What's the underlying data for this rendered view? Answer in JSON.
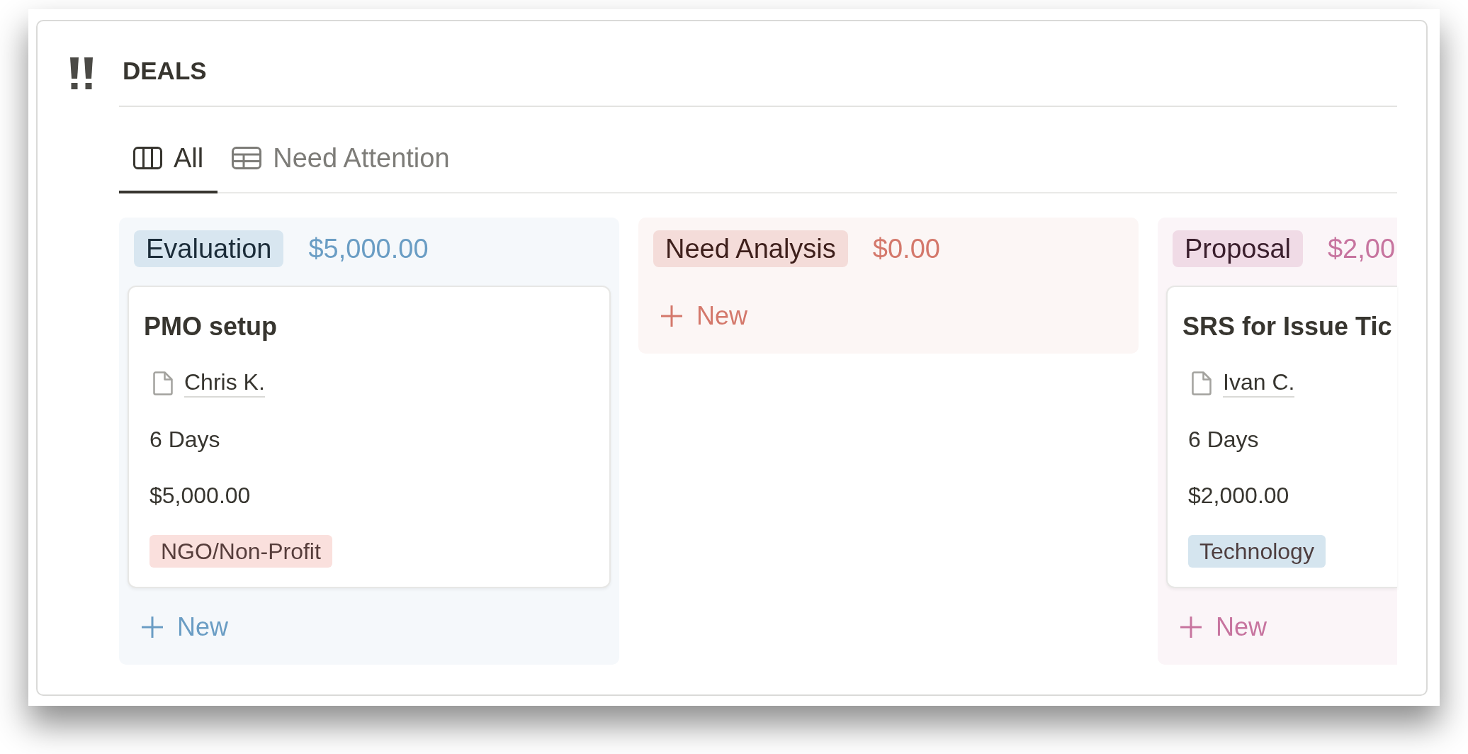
{
  "header": {
    "title": "DEALS"
  },
  "tabs": [
    {
      "label": "All",
      "kind": "board",
      "selected": true
    },
    {
      "label": "Need Attention",
      "kind": "table",
      "selected": false
    }
  ],
  "columns": [
    {
      "name": "Evaluation",
      "total": "$5,000.00",
      "color": "#6a9dc4",
      "cards": [
        {
          "title": "PMO setup",
          "owner": "Chris K.",
          "duration": "6 Days",
          "amount": "$5,000.00",
          "tags": [
            {
              "label": "NGO/Non-Profit",
              "color": "#fae0dd"
            }
          ]
        }
      ],
      "add_label": "New"
    },
    {
      "name": "Need Analysis",
      "total": "$0.00",
      "color": "#d4786b",
      "add_label": "New"
    },
    {
      "name": "Proposal",
      "total": "$2,00",
      "color": "#c7749f",
      "cards": [
        {
          "title": "SRS for Issue Tic",
          "owner": "Ivan C.",
          "duration": "6 Days",
          "amount": "$2,000.00",
          "tags": [
            {
              "label": "Technology",
              "color": "#d5e5ef"
            }
          ]
        }
      ],
      "add_label": "New"
    }
  ]
}
